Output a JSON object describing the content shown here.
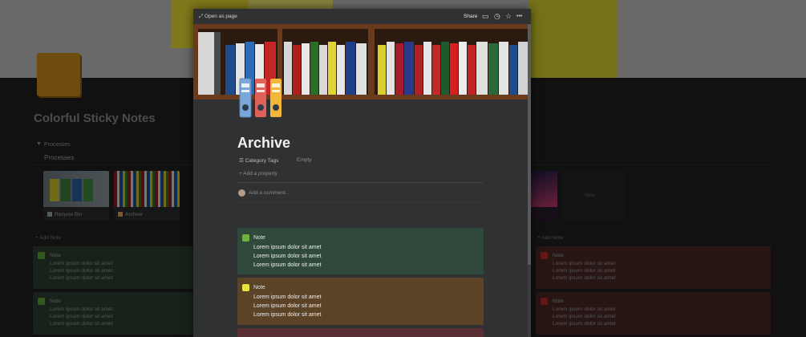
{
  "background_page": {
    "title": "Colorful Sticky Notes",
    "db_toggle_icon": "▼",
    "db_toggle_label": "Processes",
    "db_title": "Processes",
    "cards": [
      {
        "label": "Recycle Bin",
        "icon": "trash-icon"
      },
      {
        "label": "Archive",
        "icon": "binder-icon"
      }
    ],
    "new_label": "New",
    "add_note_label": "+ Add Note",
    "notes": {
      "title": "Note",
      "lines": [
        "Lorem ipsum dolor sit amet",
        "Lorem ipsum dolor sit amet",
        "Lorem ipsum dolor sit amet"
      ]
    }
  },
  "modal": {
    "open_as_page": "Open as page",
    "open_icon": "⤢",
    "share": "Share",
    "top_icons": [
      "comment-icon",
      "clock-icon",
      "star-icon",
      "more-icon"
    ],
    "top_glyphs": [
      "▭",
      "◷",
      "☆",
      "•••"
    ],
    "title": "Archive",
    "property_label": "Category Tags",
    "property_icon": "☰",
    "property_value": "Empty",
    "add_property": "+ Add a property",
    "add_comment": "Add a comment...",
    "notes": [
      {
        "title": "Note",
        "color": "#2f4a3c",
        "square": "#6fb23d",
        "lines": [
          "Lorem ipsum dolor sit amet",
          "Lorem ipsum dolor sit amet",
          "Lorem ipsum dolor sit amet"
        ]
      },
      {
        "title": "Note",
        "color": "#5a4327",
        "square": "#e8e23a",
        "lines": [
          "Lorem ipsum dolor sit amet",
          "Lorem ipsum dolor sit amet",
          "Lorem ipsum dolor sit amet"
        ]
      }
    ]
  },
  "colors": {
    "green_note": "#2c3f30",
    "red_note": "#4a2827",
    "modal_bg": "#2f3133"
  }
}
